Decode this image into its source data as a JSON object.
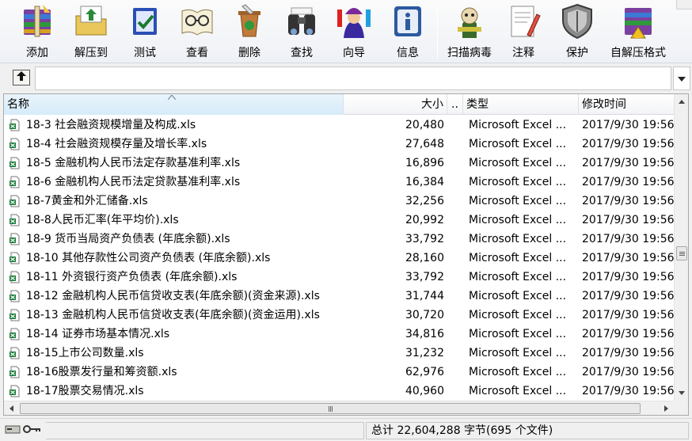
{
  "toolbar": {
    "buttons": [
      {
        "label": "添加",
        "icon": "add-archive-icon"
      },
      {
        "label": "解压到",
        "icon": "extract-to-icon"
      },
      {
        "label": "测试",
        "icon": "test-icon"
      },
      {
        "label": "查看",
        "icon": "view-icon"
      },
      {
        "label": "删除",
        "icon": "delete-icon"
      },
      {
        "label": "查找",
        "icon": "find-icon"
      },
      {
        "label": "向导",
        "icon": "wizard-icon"
      },
      {
        "label": "信息",
        "icon": "info-icon"
      },
      {
        "label": "扫描病毒",
        "icon": "virus-scan-icon"
      },
      {
        "label": "注释",
        "icon": "comment-icon"
      },
      {
        "label": "保护",
        "icon": "protect-icon"
      },
      {
        "label": "自解压格式",
        "icon": "sfx-icon"
      }
    ]
  },
  "columns": {
    "name": "名称",
    "size": "大小",
    "dots": "..",
    "type": "类型",
    "mtime": "修改时间"
  },
  "files": [
    {
      "name": "18-3  社会融资规模增量及构成.xls",
      "size": "20,480",
      "type": "Microsoft Excel ...",
      "mtime": "2017/9/30 19:56"
    },
    {
      "name": "18-4  社会融资规模存量及增长率.xls",
      "size": "27,648",
      "type": "Microsoft Excel ...",
      "mtime": "2017/9/30 19:56"
    },
    {
      "name": "18-5  金融机构人民币法定存款基准利率.xls",
      "size": "16,896",
      "type": "Microsoft Excel ...",
      "mtime": "2017/9/30 19:56"
    },
    {
      "name": "18-6  金融机构人民币法定贷款基准利率.xls",
      "size": "16,384",
      "type": "Microsoft Excel ...",
      "mtime": "2017/9/30 19:56"
    },
    {
      "name": "18-7黄金和外汇储备.xls",
      "size": "32,256",
      "type": "Microsoft Excel ...",
      "mtime": "2017/9/30 19:56"
    },
    {
      "name": "18-8人民币汇率(年平均价).xls",
      "size": "20,992",
      "type": "Microsoft Excel ...",
      "mtime": "2017/9/30 19:56"
    },
    {
      "name": "18-9  货币当局资产负债表 (年底余额).xls",
      "size": "33,792",
      "type": "Microsoft Excel ...",
      "mtime": "2017/9/30 19:56"
    },
    {
      "name": "18-10  其他存款性公司资产负债表 (年底余额).xls",
      "size": "28,160",
      "type": "Microsoft Excel ...",
      "mtime": "2017/9/30 19:56"
    },
    {
      "name": "18-11  外资银行资产负债表 (年底余额).xls",
      "size": "33,792",
      "type": "Microsoft Excel ...",
      "mtime": "2017/9/30 19:56"
    },
    {
      "name": "18-12  金融机构人民币信贷收支表(年底余额)(资金来源).xls",
      "size": "31,744",
      "type": "Microsoft Excel ...",
      "mtime": "2017/9/30 19:56"
    },
    {
      "name": "18-13  金融机构人民币信贷收支表(年底余额)(资金运用).xls",
      "size": "30,720",
      "type": "Microsoft Excel ...",
      "mtime": "2017/9/30 19:56"
    },
    {
      "name": "18-14  证券市场基本情况.xls",
      "size": "34,816",
      "type": "Microsoft Excel ...",
      "mtime": "2017/9/30 19:56"
    },
    {
      "name": "18-15上市公司数量.xls",
      "size": "31,232",
      "type": "Microsoft Excel ...",
      "mtime": "2017/9/30 19:56"
    },
    {
      "name": "18-16股票发行量和筹资额.xls",
      "size": "62,976",
      "type": "Microsoft Excel ...",
      "mtime": "2017/9/30 19:56"
    },
    {
      "name": "18-17股票交易情况.xls",
      "size": "40,960",
      "type": "Microsoft Excel ...",
      "mtime": "2017/9/30 19:56"
    }
  ],
  "status": {
    "summary": "总计 22,604,288 字节(695 个文件)"
  },
  "colors": {
    "excel_green": "#1d7a3a",
    "header_sel": "#d6ebf9"
  }
}
